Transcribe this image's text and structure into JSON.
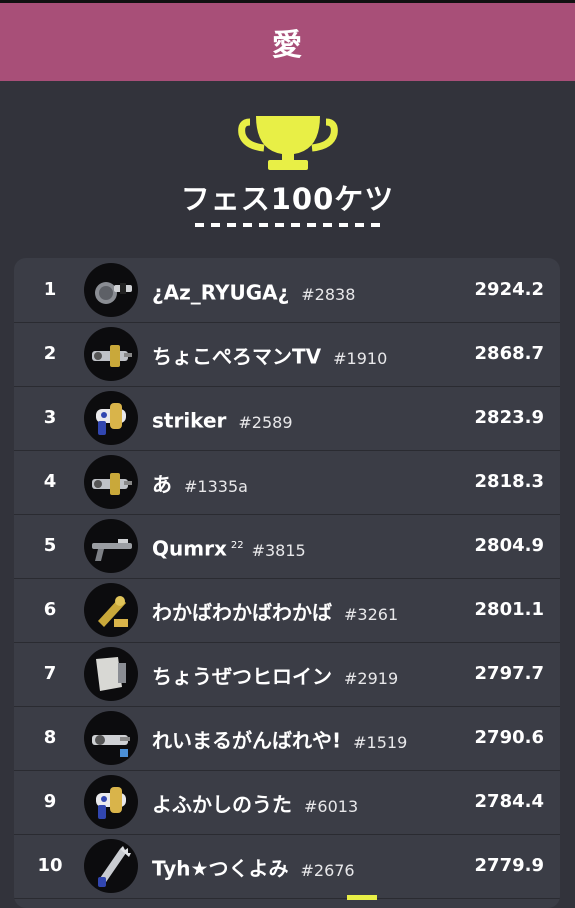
{
  "header": {
    "title": "愛"
  },
  "section": {
    "title": "フェス100ケツ"
  },
  "colors": {
    "header_bg": "#a84f78",
    "trophy": "#e8ef46",
    "bg": "#32333b",
    "panel": "#3b3d46"
  },
  "rows": [
    {
      "rank": "1",
      "name": "¿Az_RYUGA¿",
      "tag": "#2838",
      "sup": "",
      "score": "2924.2",
      "weapon": "pan-icon"
    },
    {
      "rank": "2",
      "name": " ちょこぺろマンTV",
      "tag": "#1910",
      "sup": "",
      "score": "2868.7",
      "weapon": "gold-splatling-icon"
    },
    {
      "rank": "3",
      "name": "striker",
      "tag": "#2589",
      "sup": "",
      "score": "2823.9",
      "weapon": "blaster-icon"
    },
    {
      "rank": "4",
      "name": "あ",
      "tag": "#1335a",
      "sup": "",
      "score": "2818.3",
      "weapon": "gold-splatling-icon"
    },
    {
      "rank": "5",
      "name": "Qumrx",
      "tag": "#3815",
      "sup": "22",
      "score": "2804.9",
      "weapon": "charger-icon"
    },
    {
      "rank": "6",
      "name": "わかばわかばわかば",
      "tag": "#3261",
      "sup": "",
      "score": "2801.1",
      "weapon": "splattershot-icon"
    },
    {
      "rank": "7",
      "name": "ちょうぜつヒロイン",
      "tag": "#2919",
      "sup": "",
      "score": "2797.7",
      "weapon": "brella-icon"
    },
    {
      "rank": "8",
      "name": "れいまるがんばれや!",
      "tag": "#1519",
      "sup": "",
      "score": "2790.6",
      "weapon": "splatling-icon"
    },
    {
      "rank": "9",
      "name": "よふかしのうた",
      "tag": "#6013",
      "sup": "",
      "score": "2784.4",
      "weapon": "blaster-icon"
    },
    {
      "rank": "10",
      "name": "Tyh★つくよみ",
      "tag": "#2676",
      "sup": "",
      "score": "2779.9",
      "weapon": "saw-icon"
    }
  ]
}
